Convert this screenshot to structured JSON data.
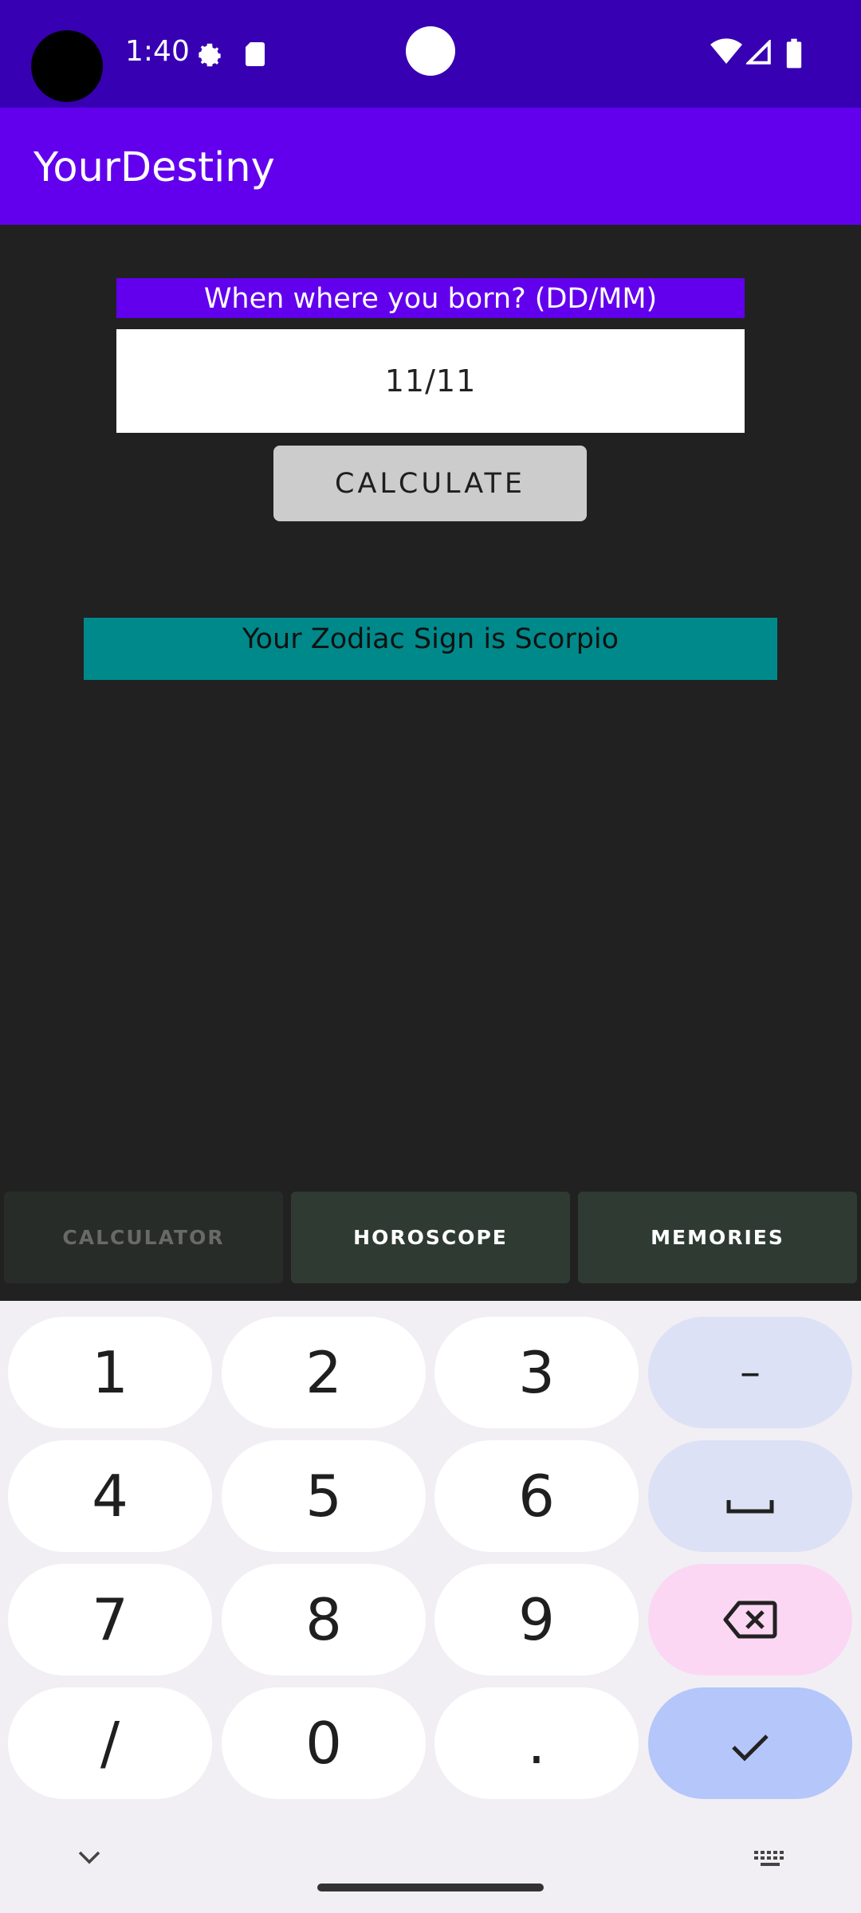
{
  "status_bar": {
    "time": "1:40",
    "icons": [
      "settings-icon",
      "sd-card-icon",
      "wifi-icon",
      "signal-icon",
      "battery-icon"
    ]
  },
  "app_bar": {
    "title": "YourDestiny"
  },
  "form": {
    "prompt": "When where you born? (DD/MM)",
    "date_value": "11/11",
    "calculate_label": "CALCULATE"
  },
  "result": {
    "text": "Your Zodiac Sign is Scorpio"
  },
  "tabs": [
    {
      "label": "CALCULATOR",
      "active": false
    },
    {
      "label": "HOROSCOPE",
      "active": true
    },
    {
      "label": "MEMORIES",
      "active": true
    }
  ],
  "keyboard": {
    "rows": [
      [
        "1",
        "2",
        "3",
        "–"
      ],
      [
        "4",
        "5",
        "6",
        "space"
      ],
      [
        "7",
        "8",
        "9",
        "delete"
      ],
      [
        "/",
        "0",
        ".",
        "done"
      ]
    ],
    "keys": {
      "k1": "1",
      "k2": "2",
      "k3": "3",
      "dash": "–",
      "k4": "4",
      "k5": "5",
      "k6": "6",
      "k7": "7",
      "k8": "8",
      "k9": "9",
      "slash": "/",
      "k0": "0",
      "dot": "."
    }
  },
  "colors": {
    "status_bar": "#3700B3",
    "app_bar": "#6200EE",
    "background": "#212121",
    "result_bg": "#00898A",
    "tab_bg": "#2f3b32"
  }
}
